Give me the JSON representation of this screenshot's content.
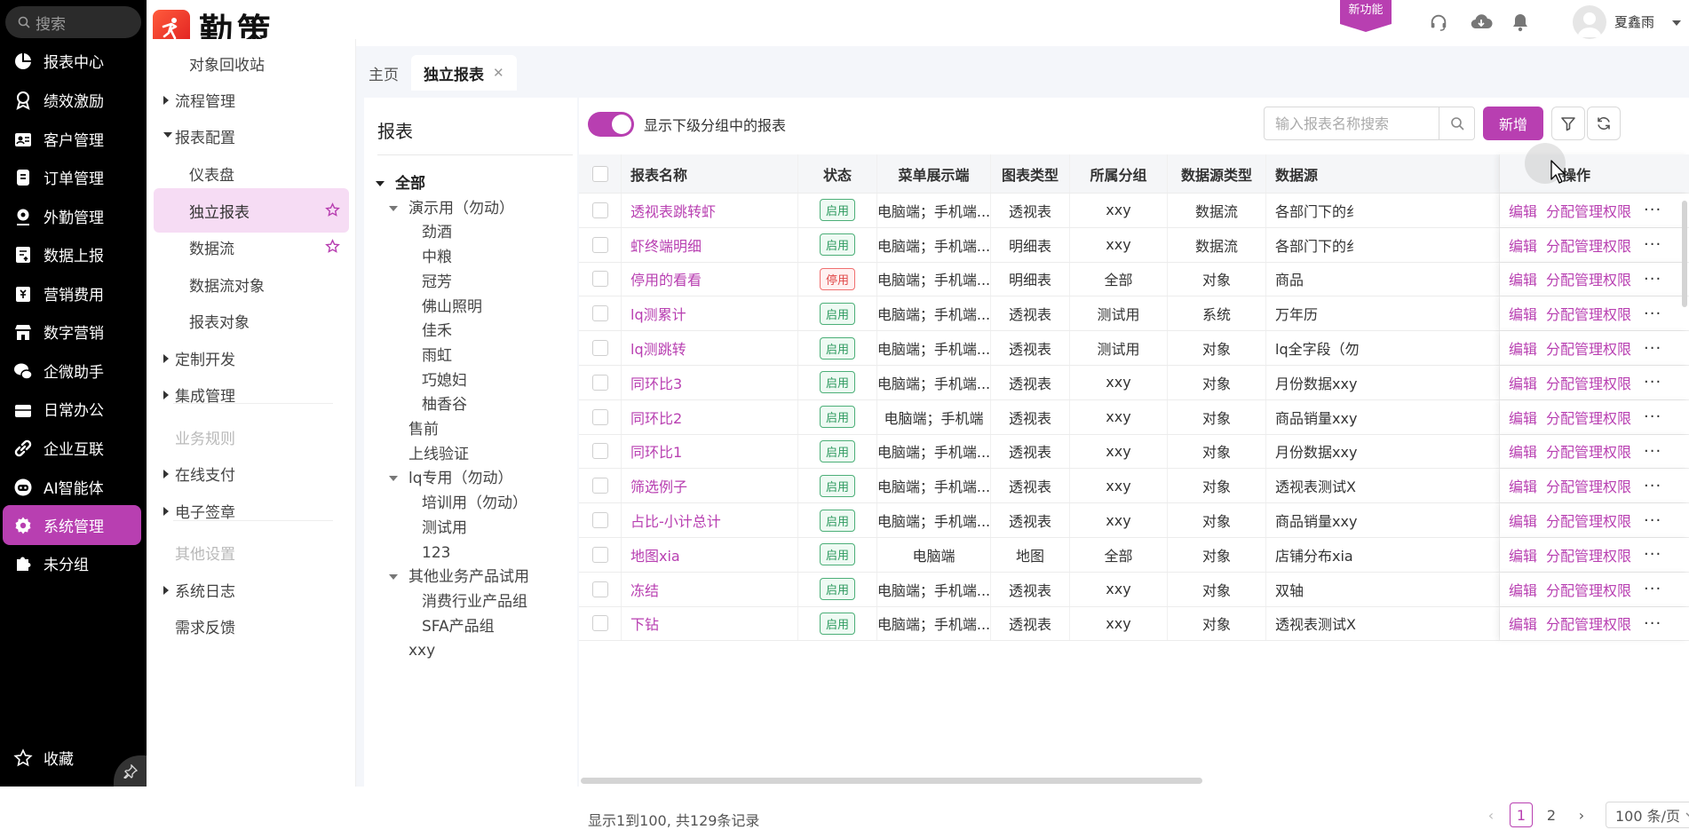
{
  "left_nav": {
    "search_placeholder": "搜索",
    "items": [
      {
        "label": "报表中心",
        "icon": "pie-chart-icon"
      },
      {
        "label": "绩效激励",
        "icon": "medal-icon"
      },
      {
        "label": "客户管理",
        "icon": "customer-icon"
      },
      {
        "label": "订单管理",
        "icon": "order-icon"
      },
      {
        "label": "外勤管理",
        "icon": "location-icon"
      },
      {
        "label": "数据上报",
        "icon": "report-upload-icon"
      },
      {
        "label": "营销费用",
        "icon": "expense-icon"
      },
      {
        "label": "数字营销",
        "icon": "store-icon"
      },
      {
        "label": "企微助手",
        "icon": "wechat-work-icon"
      },
      {
        "label": "日常办公",
        "icon": "briefcase-icon"
      },
      {
        "label": "企业互联",
        "icon": "link-icon"
      },
      {
        "label": "AI智能体",
        "icon": "robot-icon"
      },
      {
        "label": "系统管理",
        "icon": "gear-icon"
      },
      {
        "label": "未分组",
        "icon": "puzzle-icon"
      }
    ],
    "active_index": 12,
    "favorites_label": "收藏"
  },
  "sub_nav": {
    "items": [
      {
        "label": "对象回收站",
        "level": 2
      },
      {
        "label": "流程管理",
        "level": 1,
        "caret": "right"
      },
      {
        "label": "报表配置",
        "level": 1,
        "caret": "down"
      },
      {
        "label": "仪表盘",
        "level": 2
      },
      {
        "label": "独立报表",
        "level": 2,
        "active": true,
        "star": true
      },
      {
        "label": "数据流",
        "level": 2,
        "star": true
      },
      {
        "label": "数据流对象",
        "level": 2
      },
      {
        "label": "报表对象",
        "level": 2
      },
      {
        "label": "定制开发",
        "level": 1,
        "caret": "right"
      },
      {
        "label": "集成管理",
        "level": 1,
        "caret": "right"
      },
      {
        "label": "业务规则",
        "level": 1,
        "muted": true
      },
      {
        "label": "在线支付",
        "level": 1,
        "caret": "right"
      },
      {
        "label": "电子签章",
        "level": 1,
        "caret": "right"
      },
      {
        "label": "其他设置",
        "level": 1,
        "muted": true
      },
      {
        "label": "系统日志",
        "level": 1,
        "caret": "right"
      },
      {
        "label": "需求反馈",
        "level": 1
      }
    ]
  },
  "top_bar": {
    "brand": "勤策",
    "new_feature_label": "新功能",
    "user_name": "夏鑫雨"
  },
  "tabs": [
    {
      "label": "主页",
      "active": false
    },
    {
      "label": "独立报表",
      "active": true,
      "closable": true
    }
  ],
  "tree": {
    "title": "报表",
    "nodes": [
      {
        "label": "全部",
        "depth": 0,
        "caret": "down",
        "bold": true
      },
      {
        "label": "演示用（勿动）",
        "depth": 1,
        "caret": "down"
      },
      {
        "label": "劲酒",
        "depth": 2
      },
      {
        "label": "中粮",
        "depth": 2
      },
      {
        "label": "冠芳",
        "depth": 2
      },
      {
        "label": "佛山照明",
        "depth": 2
      },
      {
        "label": "佳禾",
        "depth": 2
      },
      {
        "label": "雨虹",
        "depth": 2
      },
      {
        "label": "巧媳妇",
        "depth": 2
      },
      {
        "label": "柚香谷",
        "depth": 2
      },
      {
        "label": "售前",
        "depth": 1
      },
      {
        "label": "上线验证",
        "depth": 1
      },
      {
        "label": "lq专用（勿动）",
        "depth": 1,
        "caret": "down"
      },
      {
        "label": "培训用（勿动）",
        "depth": 2
      },
      {
        "label": "测试用",
        "depth": 2
      },
      {
        "label": "123",
        "depth": 2
      },
      {
        "label": "其他业务产品试用",
        "depth": 1,
        "caret": "down"
      },
      {
        "label": "消费行业产品组",
        "depth": 2
      },
      {
        "label": "SFA产品组",
        "depth": 2
      },
      {
        "label": "xxy",
        "depth": 1
      }
    ]
  },
  "toolbar": {
    "toggle_label": "显示下级分组中的报表",
    "toggle_on": true,
    "search_placeholder": "输入报表名称搜索",
    "add_label": "新增"
  },
  "table": {
    "columns": [
      "报表名称",
      "状态",
      "菜单展示端",
      "图表类型",
      "所属分组",
      "数据源类型",
      "数据源",
      "操作"
    ],
    "rows": [
      {
        "name": "透视表跳转虾",
        "status": "启用",
        "menu": "电脑端；手机端...",
        "chart": "透视表",
        "group": "xxy",
        "src_type": "数据流",
        "src": "各部门下的纟"
      },
      {
        "name": "虾终端明细",
        "status": "启用",
        "menu": "电脑端；手机端...",
        "chart": "明细表",
        "group": "xxy",
        "src_type": "数据流",
        "src": "各部门下的纟"
      },
      {
        "name": "停用的看看",
        "status": "停用",
        "menu": "电脑端；手机端...",
        "chart": "明细表",
        "group": "全部",
        "src_type": "对象",
        "src": "商品"
      },
      {
        "name": "lq测累计",
        "status": "启用",
        "menu": "电脑端；手机端...",
        "chart": "透视表",
        "group": "测试用",
        "src_type": "系统",
        "src": "万年历"
      },
      {
        "name": "lq测跳转",
        "status": "启用",
        "menu": "电脑端；手机端...",
        "chart": "透视表",
        "group": "测试用",
        "src_type": "对象",
        "src": "lq全字段（勿"
      },
      {
        "name": "同环比3",
        "status": "启用",
        "menu": "电脑端；手机端...",
        "chart": "透视表",
        "group": "xxy",
        "src_type": "对象",
        "src": "月份数据xxy"
      },
      {
        "name": "同环比2",
        "status": "启用",
        "menu": "电脑端；手机端",
        "chart": "透视表",
        "group": "xxy",
        "src_type": "对象",
        "src": "商品销量xxy"
      },
      {
        "name": "同环比1",
        "status": "启用",
        "menu": "电脑端；手机端...",
        "chart": "透视表",
        "group": "xxy",
        "src_type": "对象",
        "src": "月份数据xxy"
      },
      {
        "name": "筛选例子",
        "status": "启用",
        "menu": "电脑端；手机端...",
        "chart": "透视表",
        "group": "xxy",
        "src_type": "对象",
        "src": "透视表测试X"
      },
      {
        "name": "占比-小计总计",
        "status": "启用",
        "menu": "电脑端；手机端...",
        "chart": "透视表",
        "group": "xxy",
        "src_type": "对象",
        "src": "商品销量xxy"
      },
      {
        "name": "地图xia",
        "status": "启用",
        "menu": "电脑端",
        "chart": "地图",
        "group": "全部",
        "src_type": "对象",
        "src": "店铺分布xia"
      },
      {
        "name": "冻结",
        "status": "启用",
        "menu": "电脑端；手机端...",
        "chart": "透视表",
        "group": "xxy",
        "src_type": "对象",
        "src": "双轴"
      },
      {
        "name": "下钻",
        "status": "启用",
        "menu": "电脑端；手机端...",
        "chart": "透视表",
        "group": "xxy",
        "src_type": "对象",
        "src": "透视表测试X"
      }
    ],
    "op_edit": "编辑",
    "op_perm": "分配管理权限",
    "op_more": "···"
  },
  "footer": {
    "total_text": "显示1到100, 共129条记录",
    "pages": [
      "1",
      "2"
    ],
    "current_page": "1",
    "page_size": "100 条/页"
  },
  "colors": {
    "accent": "#b83fb1",
    "nav_bg": "#000000",
    "active_sub_bg": "#f6dcf4",
    "enabled_green": "#2e9a5f",
    "disabled_red": "#e04848"
  }
}
